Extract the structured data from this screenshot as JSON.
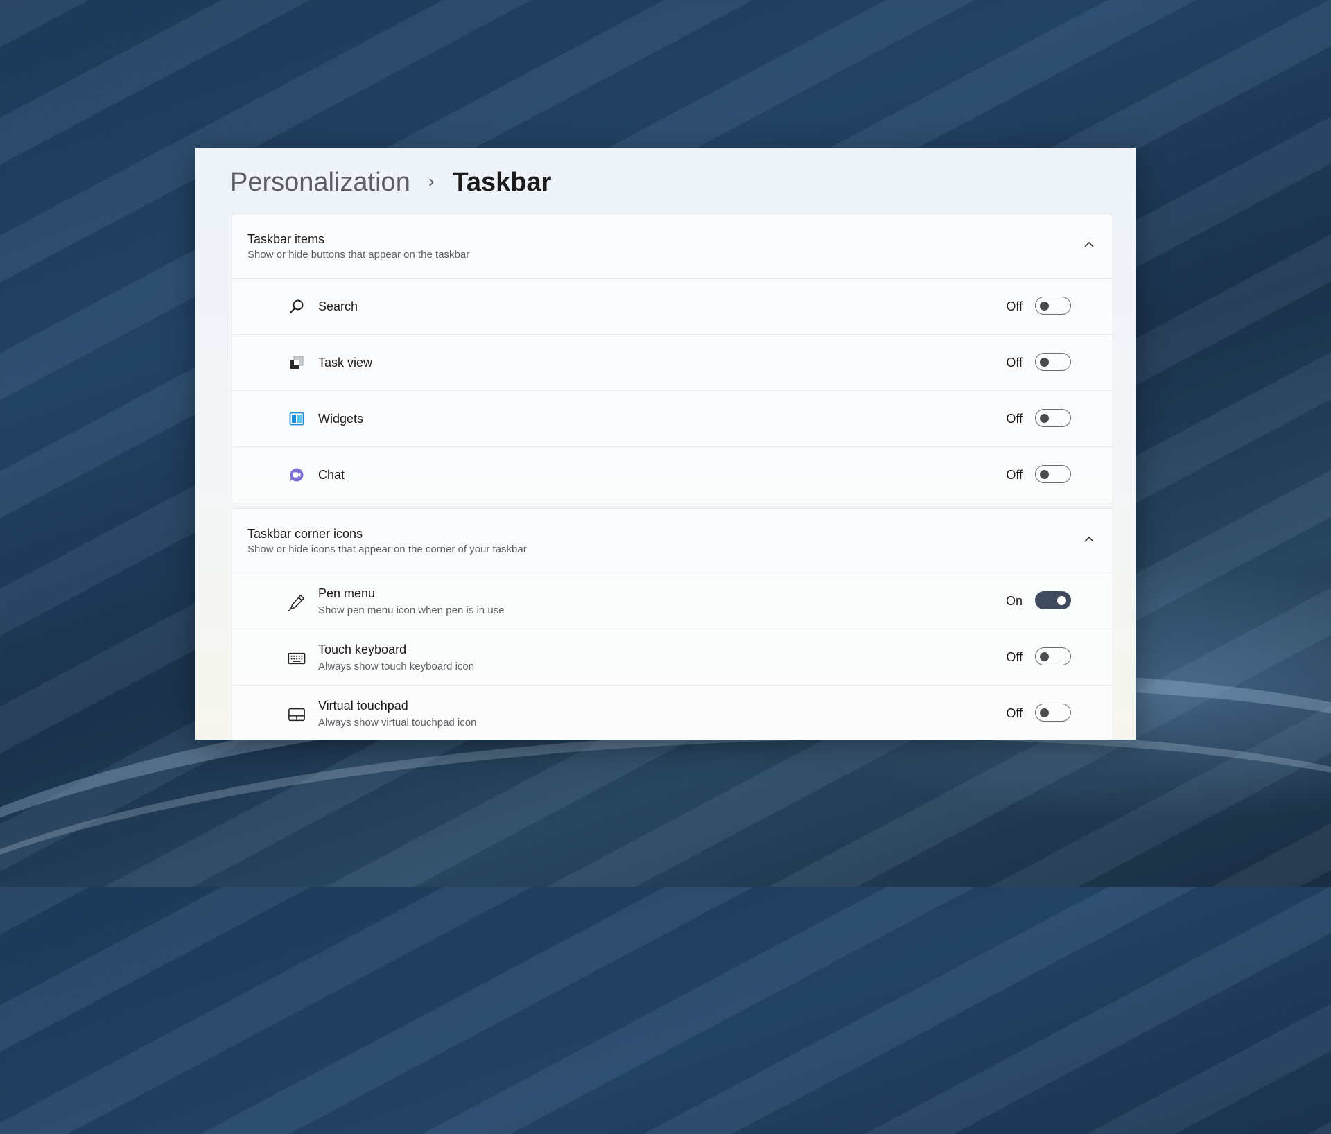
{
  "breadcrumb": {
    "parent": "Personalization",
    "separator": "›",
    "current": "Taskbar"
  },
  "colors": {
    "toggle_on": "#3f4a5e",
    "toggle_off_border": "#6a6d70",
    "widgets_icon": "#1a8fd6",
    "chat_icon": "#7b6fd6"
  },
  "taskbar_items": {
    "title": "Taskbar items",
    "subtitle": "Show or hide buttons that appear on the taskbar",
    "expanded": true,
    "items": [
      {
        "icon": "search-icon",
        "label": "Search",
        "state": "Off",
        "on": false
      },
      {
        "icon": "task-view-icon",
        "label": "Task view",
        "state": "Off",
        "on": false
      },
      {
        "icon": "widgets-icon",
        "label": "Widgets",
        "state": "Off",
        "on": false
      },
      {
        "icon": "chat-icon",
        "label": "Chat",
        "state": "Off",
        "on": false
      }
    ]
  },
  "taskbar_corner_icons": {
    "title": "Taskbar corner icons",
    "subtitle": "Show or hide icons that appear on the corner of your taskbar",
    "expanded": true,
    "items": [
      {
        "icon": "pen-icon",
        "label": "Pen menu",
        "desc": "Show pen menu icon when pen is in use",
        "state": "On",
        "on": true
      },
      {
        "icon": "keyboard-icon",
        "label": "Touch keyboard",
        "desc": "Always show touch keyboard icon",
        "state": "Off",
        "on": false
      },
      {
        "icon": "touchpad-icon",
        "label": "Virtual touchpad",
        "desc": "Always show virtual touchpad icon",
        "state": "Off",
        "on": false
      }
    ]
  }
}
